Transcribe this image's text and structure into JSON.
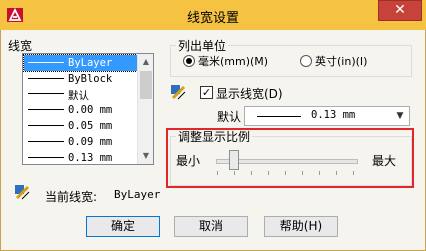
{
  "window": {
    "title": "线宽设置",
    "close_glyph": "✕"
  },
  "lineweights": {
    "label": "线宽",
    "items": [
      "ByLayer",
      "ByBlock",
      "默认",
      "0.00 mm",
      "0.05 mm",
      "0.09 mm",
      "0.13 mm"
    ],
    "selected_index": 0
  },
  "units": {
    "label": "列出单位",
    "options": [
      "毫米(mm)(M)",
      "英寸(in)(I)"
    ],
    "selected_index": 0
  },
  "display": {
    "checkbox_label": "显示线宽(D)",
    "checked": true,
    "check_glyph": "✓"
  },
  "default": {
    "label": "默认",
    "value": "0.13 mm"
  },
  "scale": {
    "label": "调整显示比例",
    "min_label": "最小",
    "max_label": "最大",
    "level": 0.1
  },
  "current": {
    "label": "当前线宽:",
    "value": "ByLayer"
  },
  "buttons": {
    "ok": "确定",
    "cancel": "取消",
    "help": "帮助(H)"
  },
  "colors": {
    "titlebar": "#f5c241",
    "close": "#c7423a",
    "highlight": "#e3262a",
    "selection": "#3399ff"
  }
}
